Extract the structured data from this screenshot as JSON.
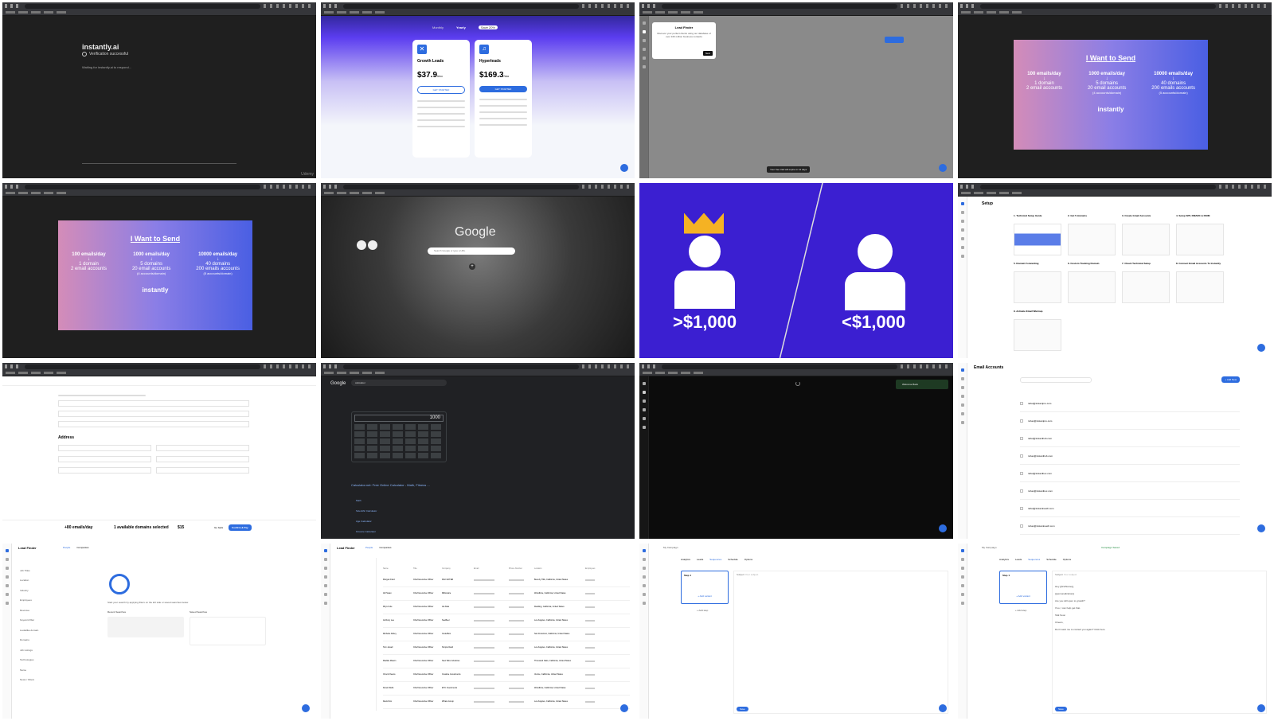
{
  "watermark": "Udemy",
  "p1": {
    "brand": "instantly.ai",
    "status": "Verification successful",
    "waiting": "Waiting for instantly.ai to respond..."
  },
  "p2": {
    "toggle": [
      "Monthly",
      "Yearly",
      "Save 20%"
    ],
    "plans": [
      {
        "name": "Growth Leads",
        "price": "$37.9",
        "per": "/mo",
        "cta": "GET STARTED",
        "icon": "x-icon"
      },
      {
        "name": "Hyperleads",
        "price": "$169.3",
        "per": "/mo",
        "cta": "GET STARTED",
        "icon": "music-icon"
      }
    ]
  },
  "p3": {
    "title": "Lead Finder",
    "body": "Discover your perfect clients using our database of over 160 million business contacts",
    "next": "Next",
    "trial": "Your free trial will expire in 14 days"
  },
  "send": {
    "title": "I Want to Send",
    "footer": "instantly",
    "cols": [
      {
        "head": "100 emails/day",
        "l1": "1 domain",
        "l2": "2 email accounts",
        "l3": ""
      },
      {
        "head": "1000 emails/day",
        "l1": "5 domains",
        "l2": "20 email accounts",
        "l3": "(4 accounts/domain)"
      },
      {
        "head": "10000 emails/day",
        "l1": "40 domains",
        "l2": "200 emails accounts",
        "l3": "(5 accounts/domain)"
      }
    ]
  },
  "p6": {
    "logo": "Google",
    "search_placeholder": "Search Google or type a URL"
  },
  "p7": {
    "left": ">$1,000",
    "right": "<$1,000",
    "accent": "#3b1fd1"
  },
  "p8": {
    "title": "Setup",
    "steps": [
      "1. Technical Setup Guide",
      "2. Get 5 domains",
      "3. Create Gmail Accounts",
      "4. Setup SPF, DMARC & DKIM",
      "5. Domain Forwarding",
      "6. Custom Tracking Domain",
      "7. Check Technical Setup",
      "8. Connect Email Accounts To Instantly",
      "9. Activate Email Warmup"
    ]
  },
  "p9": {
    "section": "Address",
    "summary_left": "+80 emails/day",
    "summary_mid": "1 available domains selected",
    "price": "$15",
    "back": "Go back",
    "confirm": "Confirm & Pay"
  },
  "p10": {
    "logo": "Google",
    "query": "calculator",
    "display": "1000",
    "result_title": "Calculator.net: Free Online Calculator - Math, Fitness ...",
    "links": [
      "Math",
      "Scientific Calculator",
      "Age Calculator",
      "Finance Calculator"
    ]
  },
  "p11": {
    "badge": "Welcome Back"
  },
  "p12": {
    "title": "Email Accounts",
    "add": "+ Add New",
    "rows": [
      "rahul@instantpro.com",
      "rohan@instantpro.com",
      "rahul@instanthub.com",
      "rohan@instanthub.com",
      "rahul@instantbox.com",
      "rohan@instantbox.com",
      "rahul@instantreach.com",
      "rohan@instantreach.com"
    ]
  },
  "p13": {
    "title": "Lead Finder",
    "tabs": [
      "People",
      "Companies"
    ],
    "filters": [
      "Job Titles",
      "Location",
      "Industry",
      "Employees",
      "Revenue",
      "Keyword filter",
      "Lookalike domain",
      "Domains",
      "Job Listings",
      "Technologies",
      "Name",
      "News / Filters"
    ],
    "prompt": "Start your search by applying filters on the left side or saved searches below.",
    "recent": "Recent Searches",
    "saved": "Saved Searches"
  },
  "p14": {
    "title": "Lead Finder",
    "tabs": [
      "People",
      "Companies"
    ],
    "cols": [
      "Name",
      "Title",
      "Company",
      "Email",
      "Phone Number",
      "Location",
      "Employees"
    ],
    "rows": [
      {
        "name": "Morgan Field",
        "title": "Chief Executive Officer",
        "company": "DAO AFTER",
        "loc": "Beverly Hills, California, United States"
      },
      {
        "name": "Ali Hasan",
        "title": "Chief Executive Officer",
        "company": "Millionaire",
        "loc": "Woodbine, California, United States"
      },
      {
        "name": "Rhys Cole",
        "title": "Chief Executive Officer",
        "company": "Ad Atlas",
        "loc": "Redding, California, United States"
      },
      {
        "name": "Anthony Lee",
        "title": "Chief Executive Officer",
        "company": "SeeBeer",
        "loc": "Los Angeles, California, United States"
      },
      {
        "name": "Michelle Abbey",
        "title": "Chief Executive Officer",
        "company": "CoderBox",
        "loc": "San Francisco, California, United States"
      },
      {
        "name": "Tom Jewell",
        "title": "Chief Executive Officer",
        "company": "Simple Dash",
        "loc": "Los Angeles, California, United States"
      },
      {
        "name": "Maddie Mason",
        "title": "Chief Executive Officer",
        "company": "New Wire Industries",
        "loc": "Thousand Oaks, California, United States"
      },
      {
        "name": "Chuck Owens",
        "title": "Chief Executive Officer",
        "company": "Creative Investments",
        "loc": "Venice, California, United States"
      },
      {
        "name": "Derek Wells",
        "title": "Chief Executive Officer",
        "company": "ETC Investments",
        "loc": "Woodbine, California, United States"
      },
      {
        "name": "David Fox",
        "title": "Chief Executive Officer",
        "company": "Whale Group",
        "loc": "Los Angeles, California, United States"
      }
    ]
  },
  "p15": {
    "title": "My Campaign",
    "tabs": [
      "Analytics",
      "Leads",
      "Sequences",
      "Schedule",
      "Options"
    ],
    "step": "Step 1",
    "subject_label": "Subject",
    "subject_ph": "Your subject",
    "add_variant": "+ Add variant",
    "add_step": "+ Add step",
    "save": "Save"
  },
  "p16": {
    "title": "My Campaign",
    "status": "Campaign Saved",
    "tabs": [
      "Analytics",
      "Leads",
      "Sequences",
      "Schedule",
      "Options"
    ],
    "step": "Step 1",
    "subject_label": "Subject",
    "subject_ph": "Your subject",
    "body": [
      "Hey {{firstName}},",
      "{{personalization}}",
      "Are you still open to growth?",
      "If so, I can help get that.",
      "Talk Soon",
      "Cheers,",
      "Don't want me to contact you again? Click here"
    ],
    "add_variant": "+ Add variant",
    "add_step": "+ Add step",
    "save": "Save"
  }
}
